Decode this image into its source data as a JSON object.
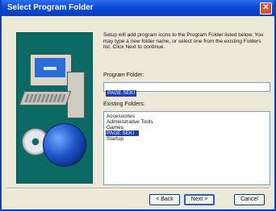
{
  "window": {
    "title": "Select Program Folder",
    "close_glyph": "✕"
  },
  "intro_text": "Setup will add program icons to the Program Folder listed below. You may type a new folder name, or select one from the existing Folders list. Click Next to continue.",
  "program_folder": {
    "label": "Program Folder:",
    "value": "PAGE SEKI"
  },
  "existing_folders": {
    "label": "Existing Folders:",
    "items": [
      "Accessories",
      "Administrative Tools",
      "Games",
      "PAGE SEKI",
      "Startup"
    ],
    "selected": "PAGE SEKI"
  },
  "buttons": {
    "back": "< Back",
    "next": "Next >",
    "cancel": "Cancel"
  },
  "art": {
    "icons": [
      "computer-icon",
      "cd-icon",
      "globe-icon"
    ],
    "bg_color": "#0b6a63"
  }
}
